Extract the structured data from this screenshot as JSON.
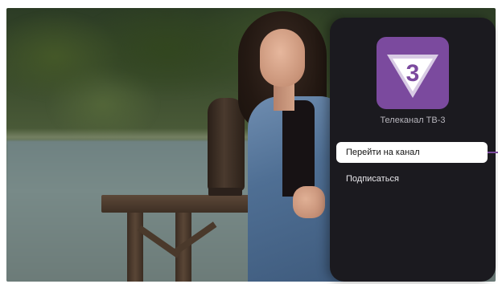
{
  "panel": {
    "channel_name": "Телеканал ТВ-3",
    "logo_glyph": "3",
    "logo_color": "#7b4a9e",
    "menu": [
      {
        "label": "Перейти на канал",
        "focused": true
      },
      {
        "label": "Подписаться",
        "focused": false
      }
    ]
  },
  "colors": {
    "panel_bg": "#1b1a1f",
    "focus_bg": "#ffffff",
    "accent": "#7b4a9e"
  }
}
